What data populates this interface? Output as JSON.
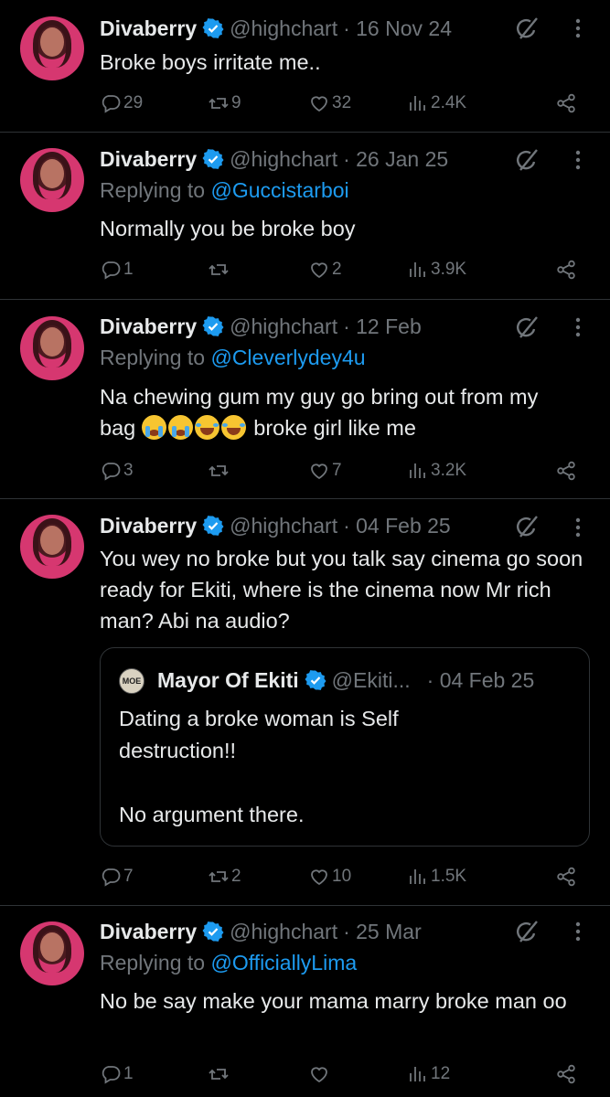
{
  "tweets": [
    {
      "name": "Divaberry",
      "handle": "@highchart",
      "date": "· 16 Nov 24",
      "text": "Broke boys irritate me..",
      "replies": "29",
      "reposts": "9",
      "likes": "32",
      "views": "2.4K"
    },
    {
      "name": "Divaberry",
      "handle": "@highchart",
      "date": "· 26 Jan 25",
      "replying_label": "Replying to",
      "replying_to": "@Guccistarboi",
      "text": "Normally you be broke boy",
      "replies": "1",
      "reposts": "",
      "likes": "2",
      "views": "3.9K"
    },
    {
      "name": "Divaberry",
      "handle": "@highchart",
      "date": "· 12 Feb",
      "replying_label": "Replying to",
      "replying_to": "@Cleverlydey4u",
      "text_line1": "Na chewing gum my guy go bring out from my",
      "text_line2_pre": "bag",
      "text_line2_post": " broke girl like me",
      "emoji_names": [
        "loudly-crying-face-emoji",
        "loudly-crying-face-emoji",
        "face-with-tears-of-joy-emoji",
        "face-with-tears-of-joy-emoji"
      ],
      "replies": "3",
      "reposts": "",
      "likes": "7",
      "views": "3.2K"
    },
    {
      "name": "Divaberry",
      "handle": "@highchart",
      "date": "· 04 Feb 25",
      "text": "You wey no broke but you talk say cinema go soon ready for Ekiti, where is the cinema now Mr rich man? Abi na audio?",
      "quote": {
        "avatar_text": "MOE",
        "name": "Mayor Of Ekiti",
        "handle": "@Ekiti...",
        "date": "· 04 Feb 25",
        "text_line1": "Dating a broke woman is Self",
        "text_line2": "destruction!!",
        "text_line3": "No argument there."
      },
      "replies": "7",
      "reposts": "2",
      "likes": "10",
      "views": "1.5K"
    },
    {
      "name": "Divaberry",
      "handle": "@highchart",
      "date": "· 25 Mar",
      "replying_label": "Replying to",
      "replying_to": "@OfficiallyLima",
      "text": "No be say make your mama marry broke man oo",
      "replies": "1",
      "reposts": "",
      "likes": "",
      "views": "12"
    }
  ],
  "colors": {
    "background": "#000000",
    "text": "#e7e9ea",
    "secondary": "#71767b",
    "link": "#1d9bf0",
    "verified": "#1d9bf0",
    "divider": "#2f3336"
  }
}
